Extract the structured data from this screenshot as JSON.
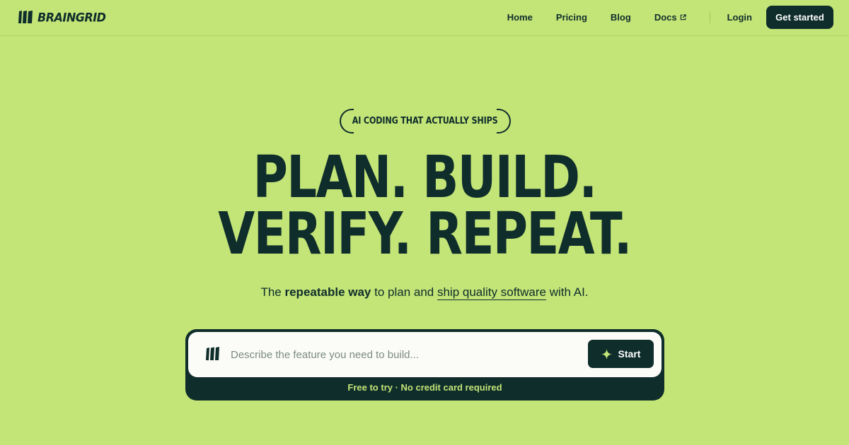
{
  "brand": {
    "name": "BRAINGRID",
    "accent": "#c3e477",
    "dark": "#0f2d2b"
  },
  "nav": {
    "links": [
      {
        "label": "Home"
      },
      {
        "label": "Pricing"
      },
      {
        "label": "Blog"
      },
      {
        "label": "Docs",
        "icon": "external-link-icon"
      }
    ],
    "login_label": "Login",
    "cta_label": "Get started"
  },
  "hero": {
    "badge": "AI CODING THAT ACTUALLY SHIPS",
    "headline_line1": "PLAN. BUILD.",
    "headline_line2": "VERIFY. REPEAT.",
    "subtitle": {
      "part1": "The ",
      "bold": "repeatable way",
      "part2": " to plan and ",
      "underlined": "ship quality software",
      "part3": " with AI."
    }
  },
  "prompt": {
    "placeholder": "Describe the feature you need to build...",
    "start_label": "Start",
    "start_icon": "sparkle-icon",
    "footer": "Free to try · No credit card required"
  }
}
